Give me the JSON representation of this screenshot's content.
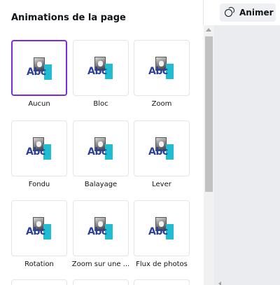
{
  "panel": {
    "title": "Animations de la page",
    "animations": [
      {
        "label": "Aucun",
        "selected": true,
        "thumbnail_text": "Abc"
      },
      {
        "label": "Bloc",
        "selected": false,
        "thumbnail_text": "Abc"
      },
      {
        "label": "Zoom",
        "selected": false,
        "thumbnail_text": "Abc"
      },
      {
        "label": "Fondu",
        "selected": false,
        "thumbnail_text": "Abc"
      },
      {
        "label": "Balayage",
        "selected": false,
        "thumbnail_text": "Abc"
      },
      {
        "label": "Lever",
        "selected": false,
        "thumbnail_text": "Abc"
      },
      {
        "label": "Rotation",
        "selected": false,
        "thumbnail_text": "Abc"
      },
      {
        "label": "Zoom sur une ...",
        "selected": false,
        "thumbnail_text": "Abc"
      },
      {
        "label": "Flux de photos",
        "selected": false,
        "thumbnail_text": "Abc"
      }
    ]
  },
  "toolbar": {
    "animate_label": "Animer",
    "animate_icon": "animate-icon"
  },
  "colors": {
    "selected_border": "#7d2ae8",
    "thumb_text": "#2b3f9e",
    "thumb_block": "#1fbcd2",
    "canvas_bg": "#ebecf0"
  }
}
